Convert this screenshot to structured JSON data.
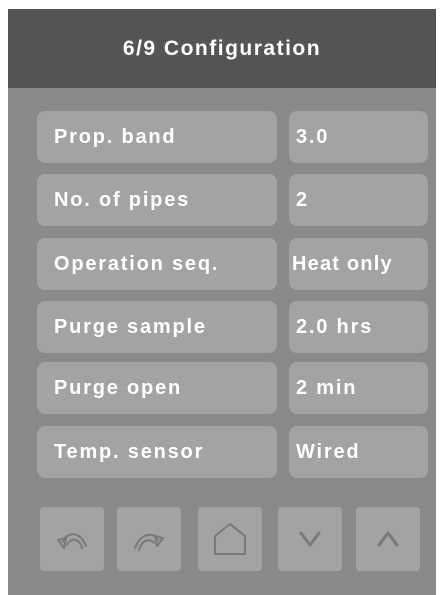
{
  "header": {
    "title": "6/9 Configuration"
  },
  "rows": [
    {
      "label": "Prop. band",
      "value": "3.0"
    },
    {
      "label": "No. of pipes",
      "value": "2"
    },
    {
      "label": "Operation seq.",
      "value": "Heat only"
    },
    {
      "label": "Purge sample",
      "value": "2.0 hrs"
    },
    {
      "label": "Purge open",
      "value": "2 min"
    },
    {
      "label": "Temp. sensor",
      "value": "Wired"
    }
  ],
  "nav": {
    "buttons": [
      {
        "icon": "undo-arrow-icon"
      },
      {
        "icon": "redo-arrow-icon"
      },
      {
        "icon": "home-icon"
      },
      {
        "icon": "chevron-down-icon"
      },
      {
        "icon": "chevron-up-icon"
      }
    ]
  },
  "colors": {
    "header_bg": "#555555",
    "panel_bg": "#8a8a8a",
    "tile_bg": "#a3a3a3",
    "text": "#ffffff",
    "icon_stroke": "#7a7a7a"
  }
}
